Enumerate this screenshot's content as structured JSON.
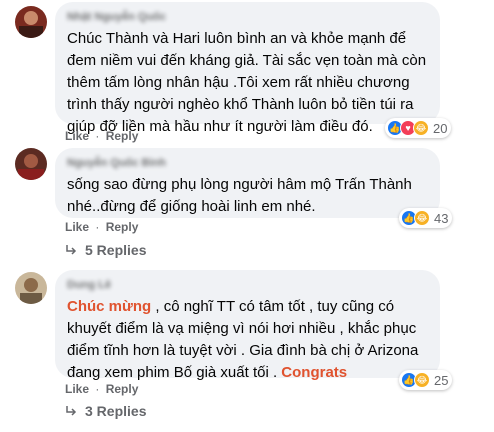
{
  "comments": [
    {
      "author": "Nhật Nguyễn Quốc",
      "text": "Chúc Thành và Hari luôn bình an và khỏe mạnh để đem niềm vui đến kháng giả. Tài sắc vẹn toàn mà còn thêm tấm lòng nhân hậu .Tôi xem rất nhiều chương trình thấy người nghèo khổ Thành luôn bỏ tiền túi ra giúp đỡ liền mà hầu như ít người làm điều đó.",
      "like_label": "Like",
      "reply_label": "Reply",
      "separator": "·",
      "reaction_count": "20"
    },
    {
      "author": "Nguyễn Quốc Bình",
      "text": "sống sao đừng phụ lòng người hâm mộ Trấn Thành nhé..đừng để giống hoài linh em nhé.",
      "like_label": "Like",
      "reply_label": "Reply",
      "separator": "·",
      "reaction_count": "43",
      "replies_label": "5 Replies"
    },
    {
      "author": "Dung Lê",
      "text_parts": {
        "highlight1": "Chúc mừng",
        "body": " , cô nghĩ TT có tâm tốt , tuy cũng có khuyết điểm là vạ miệng vì nói hơi nhiều , khắc phục điểm tĩnh hơn là tuyệt vời . Gia đình bà chị ở Arizona đang xem phim Bố già xuất tối . ",
        "highlight2": "Congrats"
      },
      "like_label": "Like",
      "reply_label": "Reply",
      "separator": "·",
      "reaction_count": "25",
      "replies_label": "3 Replies"
    }
  ],
  "colors": {
    "bubble": "#f0f2f5",
    "secondary_text": "#65676b",
    "highlight": "#e0532f",
    "like": "#1877f2",
    "love": "#f33e58",
    "haha": "#f7b125"
  },
  "icons": [
    "like-icon",
    "love-icon",
    "haha-icon",
    "reply-arrow-icon"
  ]
}
